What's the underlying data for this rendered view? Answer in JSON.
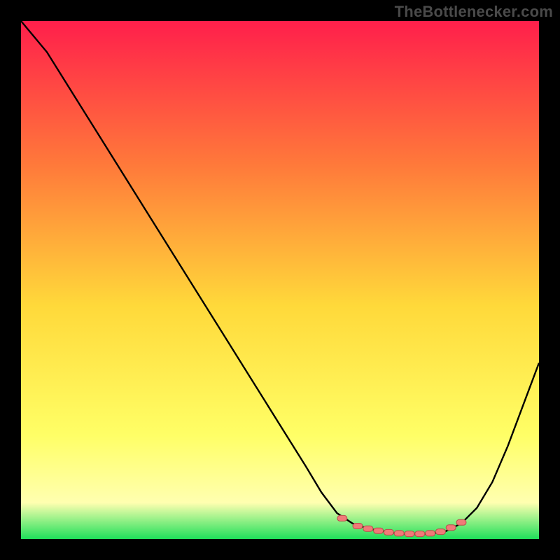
{
  "watermark": "TheBottlenecker.com",
  "colors": {
    "background": "#000000",
    "gradient_top": "#ff1f4b",
    "gradient_mid_upper": "#ff7a3a",
    "gradient_mid": "#ffd93a",
    "gradient_lower": "#ffff66",
    "gradient_near_bottom": "#ffffb0",
    "gradient_bottom": "#1fe05a",
    "curve": "#000000",
    "marker_fill": "#f07a78",
    "marker_stroke": "#b84d4b"
  },
  "chart_data": {
    "type": "line",
    "title": "",
    "xlabel": "",
    "ylabel": "",
    "xlim": [
      0,
      100
    ],
    "ylim": [
      0,
      100
    ],
    "series": [
      {
        "name": "bottleneck-curve",
        "x": [
          0,
          5,
          10,
          15,
          20,
          25,
          30,
          35,
          40,
          45,
          50,
          55,
          58,
          61,
          64,
          67,
          70,
          73,
          76,
          79,
          82,
          85,
          88,
          91,
          94,
          97,
          100
        ],
        "values": [
          100,
          94,
          86,
          78,
          70,
          62,
          54,
          46,
          38,
          30,
          22,
          14,
          9,
          5,
          3,
          2,
          1.5,
          1,
          1,
          1,
          1.5,
          3,
          6,
          11,
          18,
          26,
          34
        ]
      }
    ],
    "markers": {
      "name": "highlighted-range",
      "x": [
        62,
        65,
        67,
        69,
        71,
        73,
        75,
        77,
        79,
        81,
        83,
        85
      ],
      "values": [
        4,
        2.5,
        2,
        1.6,
        1.3,
        1.1,
        1,
        1,
        1.1,
        1.4,
        2.2,
        3.2
      ]
    }
  }
}
